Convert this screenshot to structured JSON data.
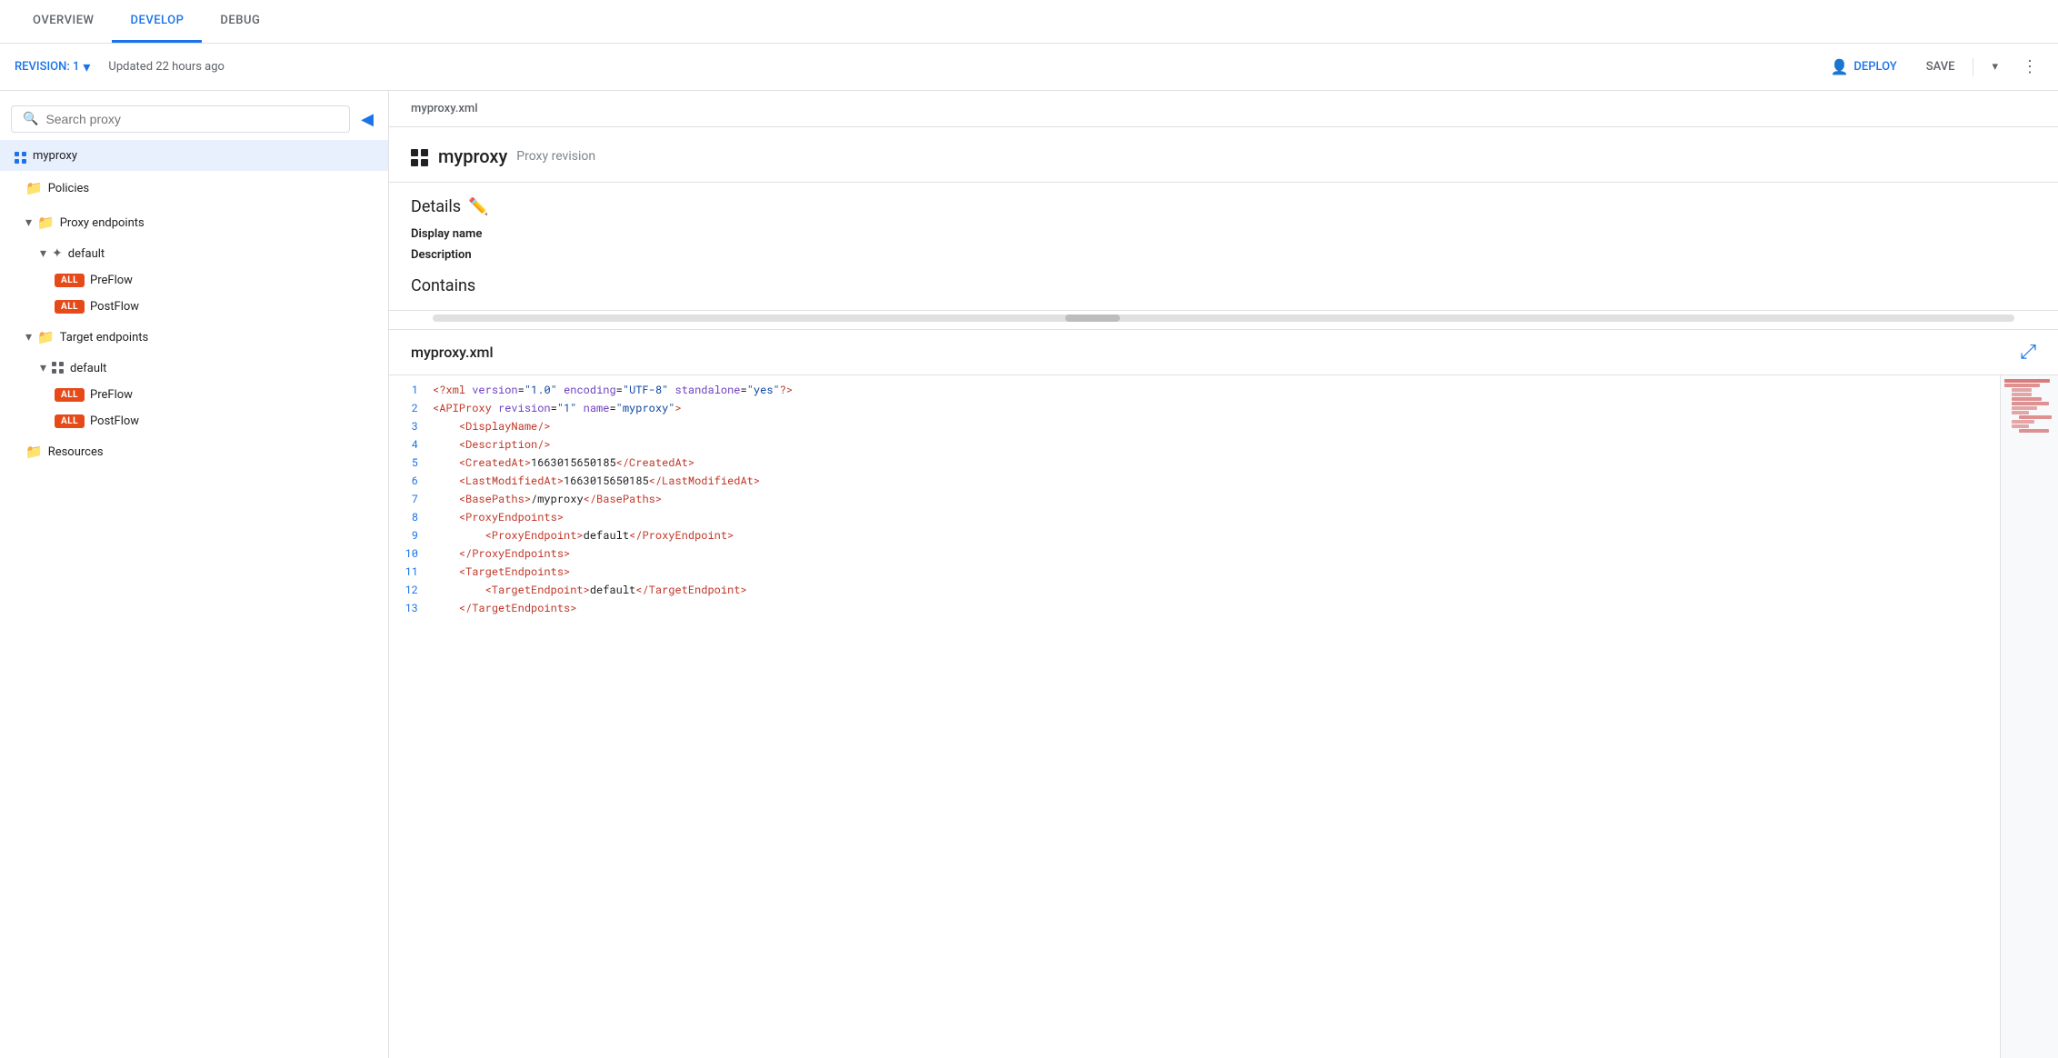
{
  "tabs": [
    {
      "id": "overview",
      "label": "OVERVIEW",
      "active": false
    },
    {
      "id": "develop",
      "label": "DEVELOP",
      "active": true
    },
    {
      "id": "debug",
      "label": "DEBUG",
      "active": false
    }
  ],
  "toolbar": {
    "revision_label": "REVISION: 1",
    "updated_text": "Updated 22 hours ago",
    "deploy_label": "DEPLOY",
    "save_label": "SAVE"
  },
  "sidebar": {
    "search_placeholder": "Search proxy",
    "items": [
      {
        "id": "myproxy",
        "label": "myproxy",
        "indent": 0,
        "type": "proxy",
        "selected": true
      },
      {
        "id": "policies",
        "label": "Policies",
        "indent": 1,
        "type": "folder",
        "has_add": true
      },
      {
        "id": "proxy-endpoints",
        "label": "Proxy endpoints",
        "indent": 1,
        "type": "folder-expandable",
        "expanded": true,
        "has_add": true
      },
      {
        "id": "default-proxy",
        "label": "default",
        "indent": 2,
        "type": "target-icon",
        "expanded": true
      },
      {
        "id": "preflow-proxy",
        "label": "PreFlow",
        "indent": 3,
        "type": "badge-item"
      },
      {
        "id": "postflow-proxy",
        "label": "PostFlow",
        "indent": 3,
        "type": "badge-item"
      },
      {
        "id": "target-endpoints",
        "label": "Target endpoints",
        "indent": 1,
        "type": "folder-expandable",
        "expanded": true,
        "has_add": true
      },
      {
        "id": "default-target",
        "label": "default",
        "indent": 2,
        "type": "grid-icon",
        "expanded": true
      },
      {
        "id": "preflow-target",
        "label": "PreFlow",
        "indent": 3,
        "type": "badge-item"
      },
      {
        "id": "postflow-target",
        "label": "PostFlow",
        "indent": 3,
        "type": "badge-item"
      },
      {
        "id": "resources",
        "label": "Resources",
        "indent": 1,
        "type": "folder",
        "has_add": true
      }
    ]
  },
  "content": {
    "breadcrumb": "myproxy.xml",
    "proxy_name": "myproxy",
    "proxy_subtitle": "Proxy revision",
    "details_title": "Details",
    "display_name_label": "Display name",
    "description_label": "Description",
    "contains_title": "Contains",
    "xml_filename": "myproxy.xml",
    "code_lines": [
      {
        "num": 1,
        "html_id": "line1",
        "text": "<?xml version=\"1.0\" encoding=\"UTF-8\" standalone=\"yes\"?>"
      },
      {
        "num": 2,
        "html_id": "line2",
        "text": "<APIProxy revision=\"1\" name=\"myproxy\">"
      },
      {
        "num": 3,
        "html_id": "line3",
        "text": "    <DisplayName/>"
      },
      {
        "num": 4,
        "html_id": "line4",
        "text": "    <Description/>"
      },
      {
        "num": 5,
        "html_id": "line5",
        "text": "    <CreatedAt>1663015650185</CreatedAt>"
      },
      {
        "num": 6,
        "html_id": "line6",
        "text": "    <LastModifiedAt>1663015650185</LastModifiedAt>"
      },
      {
        "num": 7,
        "html_id": "line7",
        "text": "    <BasePaths>/myproxy</BasePaths>"
      },
      {
        "num": 8,
        "html_id": "line8",
        "text": "    <ProxyEndpoints>"
      },
      {
        "num": 9,
        "html_id": "line9",
        "text": "        <ProxyEndpoint>default</ProxyEndpoint>"
      },
      {
        "num": 10,
        "html_id": "line10",
        "text": "    </ProxyEndpoints>"
      },
      {
        "num": 11,
        "html_id": "line11",
        "text": "    <TargetEndpoints>"
      },
      {
        "num": 12,
        "html_id": "line12",
        "text": "        <TargetEndpoint>default</TargetEndpoint>"
      },
      {
        "num": 13,
        "html_id": "line13",
        "text": "    </TargetEndpoints>"
      }
    ]
  },
  "colors": {
    "blue": "#1a73e8",
    "orange": "#e64a19",
    "gray": "#5f6368",
    "text": "#202124"
  }
}
